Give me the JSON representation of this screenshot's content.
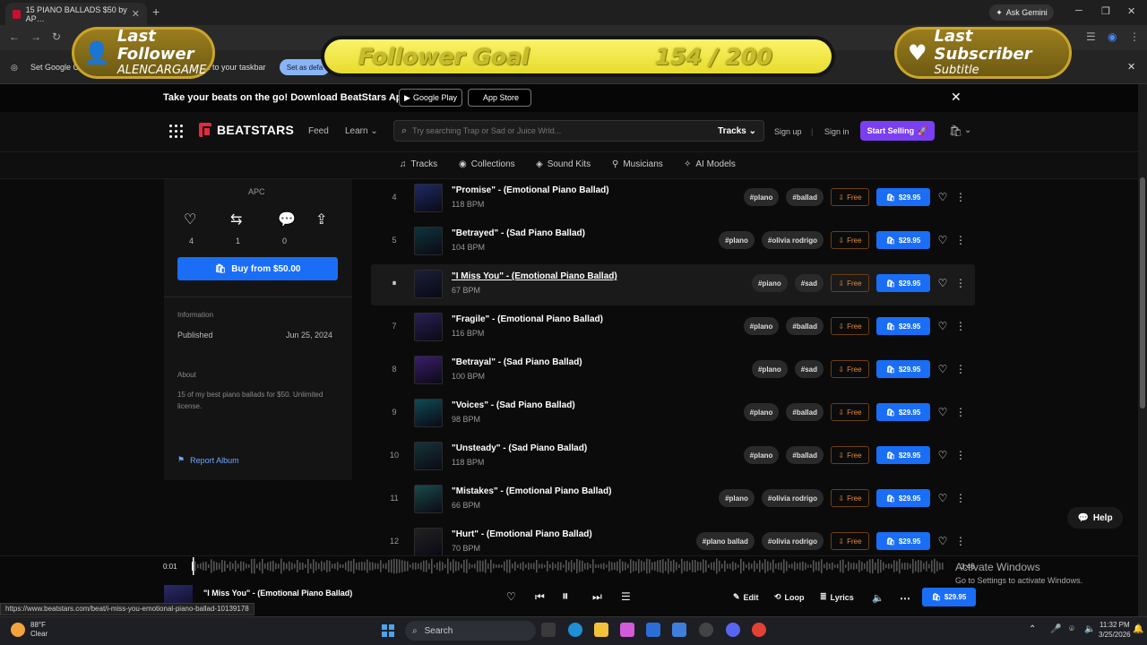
{
  "browser": {
    "tab_title": "15 PIANO BALLADS $50 by AP…",
    "ask_gemini": "Ask Gemini",
    "infobar_left": "Set Google C",
    "infobar_right": "t to your taskbar",
    "infobar_button": "Set as defa",
    "status_url": "https://www.beatstars.com/beat/i-miss-you-emotional-piano-ballad-10139178"
  },
  "overlays": {
    "last_follower_title": "Last Follower",
    "last_follower_name": "ALENCARGAME",
    "follower_goal_label": "Follower Goal",
    "follower_goal_progress": "154 / 200",
    "follower_goal_fraction": 0.77,
    "last_subscriber_title": "Last Subscriber",
    "last_subscriber_name": "Subtitle"
  },
  "promo": {
    "text": "Take your beats on the go! Download BeatStars App",
    "google_play": "Google Play",
    "app_store": "App Store"
  },
  "header": {
    "logo": "BEATSTARS",
    "feed": "Feed",
    "learn": "Learn",
    "search_placeholder": "Try searching Trap or Sad or Juice Wrld...",
    "search_scope": "Tracks",
    "sign_up": "Sign up",
    "sign_in": "Sign in",
    "start_selling": "Start Selling"
  },
  "subnav": {
    "tracks": "Tracks",
    "collections": "Collections",
    "sound_kits": "Sound Kits",
    "musicians": "Musicians",
    "ai_models": "AI Models"
  },
  "album": {
    "author": "APC",
    "likes": "4",
    "reposts": "1",
    "comments": "0",
    "buy_label": "Buy from $50.00",
    "information_label": "Information",
    "published_label": "Published",
    "published_date": "Jun 25, 2024",
    "about_label": "About",
    "about_text": "15 of my best piano ballads for $50. Unlimited license.",
    "report_label": "Report Album"
  },
  "tracks": [
    {
      "num": "4",
      "title": "\"Promise\" - (Emotional Piano Ballad)",
      "bpm": "118 BPM",
      "tags": [
        "#plano",
        "#ballad"
      ],
      "free": "Free",
      "price": "$29.95"
    },
    {
      "num": "5",
      "title": "\"Betrayed\" - (Sad Piano Ballad)",
      "bpm": "104 BPM",
      "tags": [
        "#plano",
        "#olivia rodrigo"
      ],
      "free": "Free",
      "price": "$29.95"
    },
    {
      "num": "",
      "title": "\"I Miss You\" - (Emotional Piano Ballad)",
      "bpm": "67 BPM",
      "tags": [
        "#piano",
        "#sad"
      ],
      "free": "Free",
      "price": "$29.95"
    },
    {
      "num": "7",
      "title": "\"Fragile\" - (Emotional Piano Ballad)",
      "bpm": "116 BPM",
      "tags": [
        "#plano",
        "#ballad"
      ],
      "free": "Free",
      "price": "$29.95"
    },
    {
      "num": "8",
      "title": "\"Betrayal\" - (Sad Piano Ballad)",
      "bpm": "100 BPM",
      "tags": [
        "#plano",
        "#sad"
      ],
      "free": "Free",
      "price": "$29.95"
    },
    {
      "num": "9",
      "title": "\"Voices\" - (Sad Piano Ballad)",
      "bpm": "98 BPM",
      "tags": [
        "#plano",
        "#ballad"
      ],
      "free": "Free",
      "price": "$29.95"
    },
    {
      "num": "10",
      "title": "\"Unsteady\" - (Sad Piano Ballad)",
      "bpm": "118 BPM",
      "tags": [
        "#plano",
        "#ballad"
      ],
      "free": "Free",
      "price": "$29.95"
    },
    {
      "num": "11",
      "title": "\"Mistakes\" - (Emotional Piano Ballad)",
      "bpm": "66 BPM",
      "tags": [
        "#plano",
        "#olivia rodrigo"
      ],
      "free": "Free",
      "price": "$29.95"
    },
    {
      "num": "12",
      "title": "\"Hurt\" - (Emotional Piano Ballad)",
      "bpm": "70 BPM",
      "tags": [
        "#plano ballad",
        "#olivia rodrigo"
      ],
      "free": "Free",
      "price": "$29.95"
    }
  ],
  "help": "Help",
  "player": {
    "time_current": "0:01",
    "time_total": "3:46",
    "title": "\"I Miss You\" - (Emotional Piano Ballad)",
    "edit": "Edit",
    "loop": "Loop",
    "lyrics": "Lyrics",
    "price": "$29.95"
  },
  "windows": {
    "activate_title": "Activate Windows",
    "activate_sub": "Go to Settings to activate Windows.",
    "weather_temp": "88°F",
    "weather_desc": "Clear",
    "search": "Search",
    "time": "11:32 PM",
    "date": "3/25/2026"
  },
  "colors": {
    "accent_blue": "#1a6ef5",
    "start_selling_purple": "#7b3ff2",
    "brand_red": "#e32b40",
    "free_orange": "#e68b3a"
  }
}
